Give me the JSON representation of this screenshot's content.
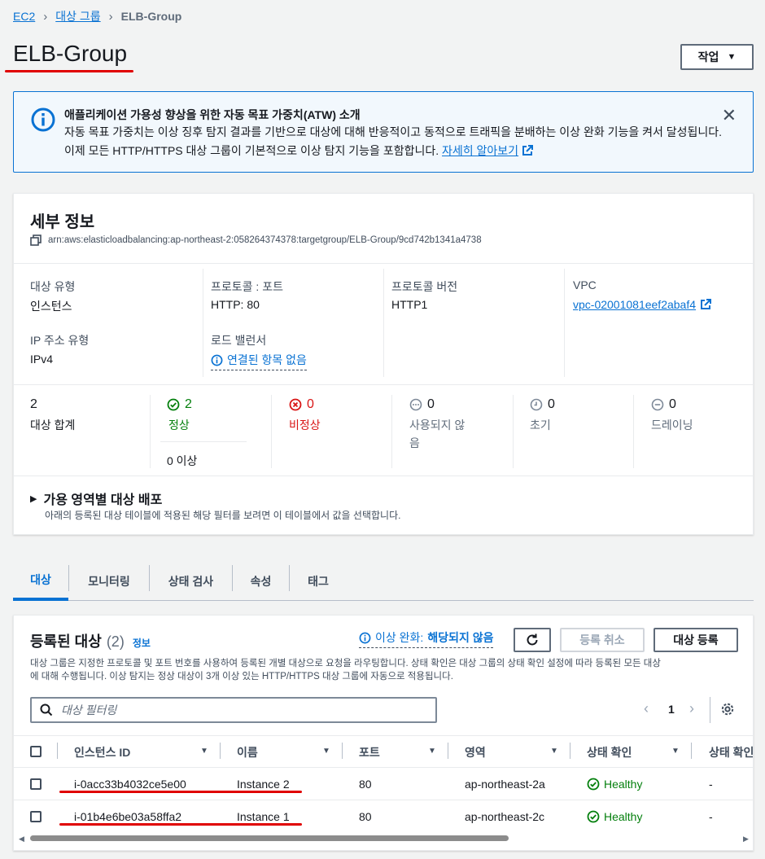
{
  "breadcrumb": {
    "root": "EC2",
    "parent": "대상 그룹",
    "current": "ELB-Group"
  },
  "page_title": "ELB-Group",
  "actions_button": "작업",
  "banner": {
    "title": "애플리케이션 가용성 향상을 위한 자동 목표 가중치(ATW) 소개",
    "text": "자동 목표 가중치는 이상 징후 탐지 결과를 기반으로 대상에 대해 반응적이고 동적으로 트래픽을 분배하는 이상 완화 기능을 켜서 달성됩니다. 이제 모든 HTTP/HTTPS 대상 그룹이 기본적으로 이상 탐지 기능을 포함합니다.",
    "link": "자세히 알아보기"
  },
  "details": {
    "title": "세부 정보",
    "arn": "arn:aws:elasticloadbalancing:ap-northeast-2:058264374378:targetgroup/ELB-Group/9cd742b1341a4738",
    "target_type_label": "대상 유형",
    "target_type": "인스턴스",
    "protocol_port_label": "프로토콜 : 포트",
    "protocol_port": "HTTP: 80",
    "protocol_version_label": "프로토콜 버전",
    "protocol_version": "HTTP1",
    "vpc_label": "VPC",
    "vpc": "vpc-02001081eef2abaf4",
    "ip_type_label": "IP 주소 유형",
    "ip_type": "IPv4",
    "lb_label": "로드 밸런서",
    "lb_value": "연결된 항목 없음"
  },
  "stats": {
    "total": "2",
    "total_label": "대상 합계",
    "healthy": "2",
    "healthy_label": "정상",
    "anomalous": "0 이상",
    "unhealthy": "0",
    "unhealthy_label": "비정상",
    "unused": "0",
    "unused_label_1": "사용되지 않",
    "unused_label_2": "음",
    "initial": "0",
    "initial_label": "초기",
    "draining": "0",
    "draining_label": "드레이닝"
  },
  "az_section": {
    "title": "가용 영역별 대상 배포",
    "desc": "아래의 등록된 대상 테이블에 적용된 해당 필터를 보려면 이 테이블에서 값을 선택합니다."
  },
  "tabs": [
    "대상",
    "모니터링",
    "상태 검사",
    "속성",
    "태그"
  ],
  "targets": {
    "title": "등록된 대상",
    "count": "(2)",
    "info": "정보",
    "mitigation_label": "이상 완화:",
    "mitigation_value": "해당되지 않음",
    "deregister": "등록 취소",
    "register": "대상 등록",
    "desc_1": "대상 그룹은 지정한 프로토콜 및 포트 번호를 사용하여 등록된 개별 대상으로 요청을 라우팅합니다. 상태 확인은 대상 그룹의 상태 확인 설정에 따라 등록된 모든 대상",
    "desc_2": "에 대해 수행됩니다. 이상 탐지는 정상 대상이 3개 이상 있는 HTTP/HTTPS 대상 그룹에 자동으로 적용됩니다.",
    "filter_placeholder": "대상 필터링",
    "page": "1",
    "columns": [
      "인스턴스 ID",
      "이름",
      "포트",
      "영역",
      "상태 확인",
      "상태 확인"
    ],
    "rows": [
      {
        "id": "i-0acc33b4032ce5e00",
        "name": "Instance 2",
        "port": "80",
        "zone": "ap-northeast-2a",
        "health": "Healthy",
        "detail": "-"
      },
      {
        "id": "i-01b4e6be03a58ffa2",
        "name": "Instance 1",
        "port": "80",
        "zone": "ap-northeast-2c",
        "health": "Healthy",
        "detail": "-"
      }
    ]
  }
}
